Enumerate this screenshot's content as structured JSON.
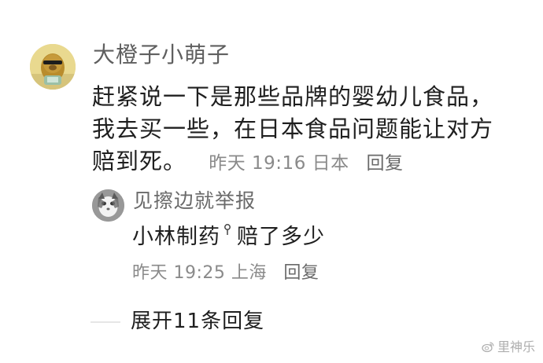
{
  "comment": {
    "author": "大橙子小萌子",
    "text_lines": [
      "赶紧说一下是那些品牌的婴幼儿食品，",
      "我去买一些，在日本食品问题能让对方",
      "赔到死。"
    ],
    "meta": "昨天 19:16 日本",
    "reply_label": "回复"
  },
  "reply": {
    "author": "见擦边就举报",
    "mention": "小林制药",
    "text": "赔了多少",
    "meta": "昨天 19:25 上海",
    "reply_label": "回复"
  },
  "expand": {
    "label": "展开11条回复"
  },
  "watermark": {
    "text": "里神乐"
  },
  "icons": {
    "main_avatar": "avatar-dog-icon",
    "reply_avatar": "avatar-cat-icon",
    "mention_badge": "badge-icon",
    "watermark_logo": "weibo-logo-icon"
  }
}
